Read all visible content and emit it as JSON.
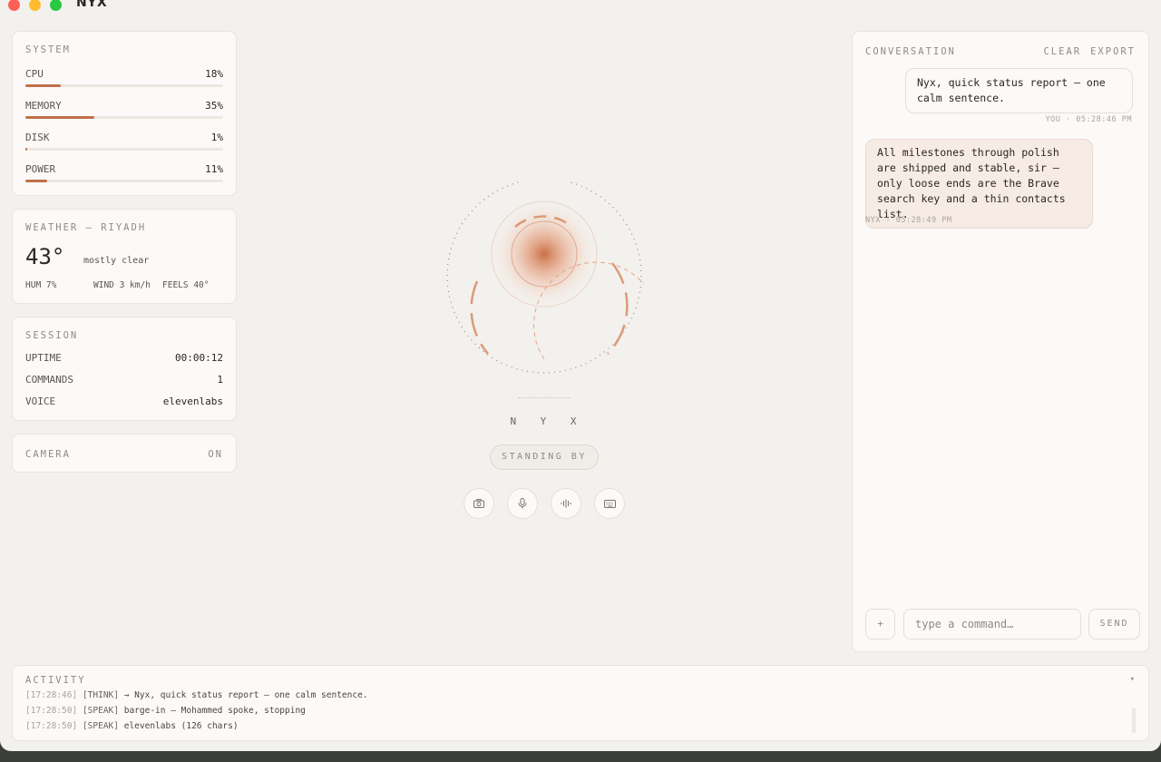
{
  "app": {
    "title": "NYX"
  },
  "system": {
    "title": "SYSTEM",
    "metrics": [
      {
        "label": "CPU",
        "value": "18%",
        "fraction": 0.18
      },
      {
        "label": "MEMORY",
        "value": "35%",
        "fraction": 0.35
      },
      {
        "label": "DISK",
        "value": "1%",
        "fraction": 0.01
      },
      {
        "label": "POWER",
        "value": "11%",
        "fraction": 0.11
      }
    ]
  },
  "weather": {
    "title": "WEATHER — RIYADH",
    "temp": "43°",
    "condition": "mostly clear",
    "humidity": "HUM 7%",
    "wind": "WIND 3 km/h",
    "feels": "FEELS 40°"
  },
  "session": {
    "title": "SESSION",
    "rows": [
      {
        "label": "UPTIME",
        "value": "00:00:12"
      },
      {
        "label": "COMMANDS",
        "value": "1"
      },
      {
        "label": "VOICE",
        "value": "elevenlabs"
      }
    ]
  },
  "camera": {
    "title": "CAMERA",
    "state": "ON"
  },
  "assistant": {
    "name": "N Y X",
    "status": "STANDING BY"
  },
  "controls": {
    "icons": [
      "camera-icon",
      "microphone-icon",
      "waveform-icon",
      "keyboard-icon"
    ]
  },
  "conversation": {
    "title": "CONVERSATION",
    "clear_label": "CLEAR",
    "export_label": "EXPORT",
    "messages": [
      {
        "from": "user",
        "text": "Nyx, quick status report — one calm sentence.",
        "meta": "YOU · 05:28:46 PM"
      },
      {
        "from": "nyx",
        "text": "All milestones through polish are shipped and stable, sir — only loose ends are the Brave search key and a thin contacts list.",
        "meta": "NYX · 05:28:49 PM"
      }
    ],
    "plus_label": "+",
    "input_placeholder": "type a command…",
    "send_label": "SEND"
  },
  "activity": {
    "title": "ACTIVITY",
    "toggle": "▾",
    "logs": [
      {
        "ts": "[17:28:46]",
        "tag": "[THINK]",
        "text": "→ Nyx, quick status report — one calm sentence."
      },
      {
        "ts": "[17:28:50]",
        "tag": "[SPEAK]",
        "text": "barge-in — Mohammed spoke, stopping"
      },
      {
        "ts": "[17:28:50]",
        "tag": "[SPEAK]",
        "text": "elevenlabs (126 chars)"
      }
    ]
  },
  "colors": {
    "accent": "#c0704a",
    "background": "#f3f1ee",
    "card": "#fbfaf8"
  }
}
